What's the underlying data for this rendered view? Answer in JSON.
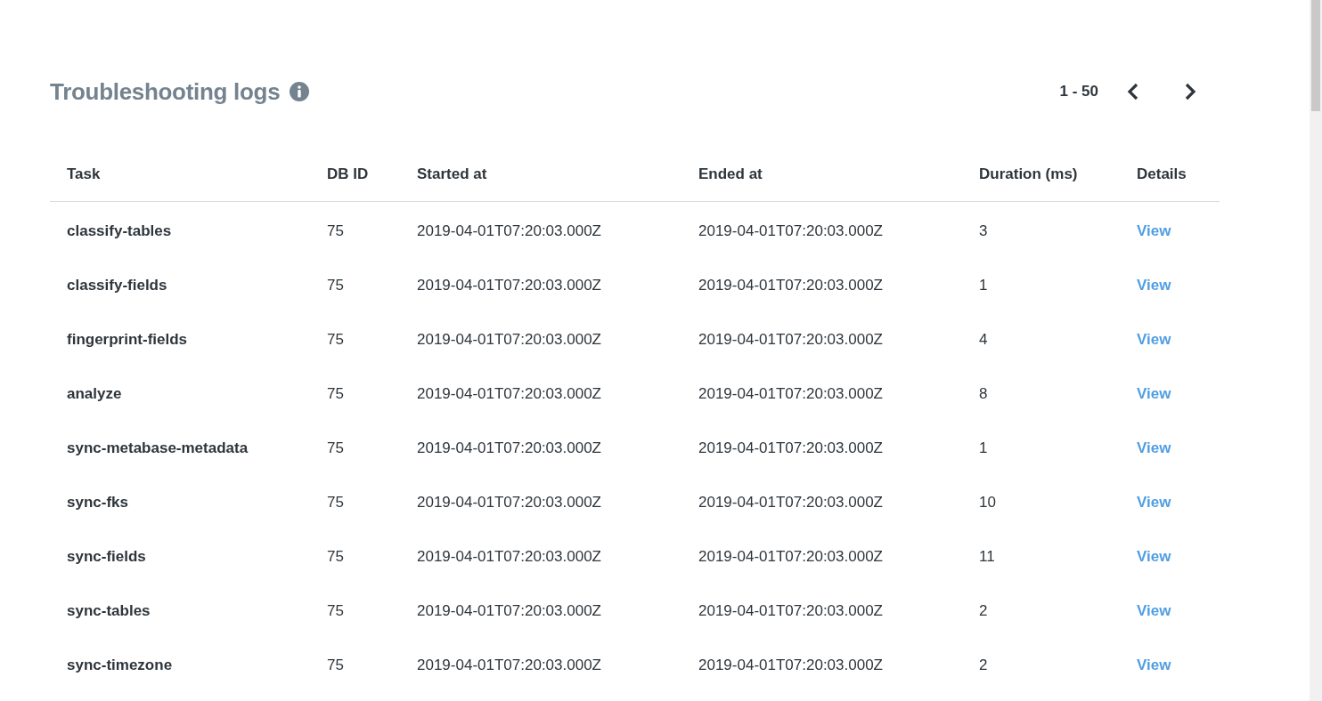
{
  "header": {
    "title": "Troubleshooting logs",
    "pagination": {
      "range": "1 - 50"
    }
  },
  "table": {
    "columns": [
      "Task",
      "DB ID",
      "Started at",
      "Ended at",
      "Duration (ms)",
      "Details"
    ],
    "rows": [
      {
        "task": "classify-tables",
        "db_id": "75",
        "started_at": "2019-04-01T07:20:03.000Z",
        "ended_at": "2019-04-01T07:20:03.000Z",
        "duration": "3",
        "details": "View"
      },
      {
        "task": "classify-fields",
        "db_id": "75",
        "started_at": "2019-04-01T07:20:03.000Z",
        "ended_at": "2019-04-01T07:20:03.000Z",
        "duration": "1",
        "details": "View"
      },
      {
        "task": "fingerprint-fields",
        "db_id": "75",
        "started_at": "2019-04-01T07:20:03.000Z",
        "ended_at": "2019-04-01T07:20:03.000Z",
        "duration": "4",
        "details": "View"
      },
      {
        "task": "analyze",
        "db_id": "75",
        "started_at": "2019-04-01T07:20:03.000Z",
        "ended_at": "2019-04-01T07:20:03.000Z",
        "duration": "8",
        "details": "View"
      },
      {
        "task": "sync-metabase-metadata",
        "db_id": "75",
        "started_at": "2019-04-01T07:20:03.000Z",
        "ended_at": "2019-04-01T07:20:03.000Z",
        "duration": "1",
        "details": "View"
      },
      {
        "task": "sync-fks",
        "db_id": "75",
        "started_at": "2019-04-01T07:20:03.000Z",
        "ended_at": "2019-04-01T07:20:03.000Z",
        "duration": "10",
        "details": "View"
      },
      {
        "task": "sync-fields",
        "db_id": "75",
        "started_at": "2019-04-01T07:20:03.000Z",
        "ended_at": "2019-04-01T07:20:03.000Z",
        "duration": "11",
        "details": "View"
      },
      {
        "task": "sync-tables",
        "db_id": "75",
        "started_at": "2019-04-01T07:20:03.000Z",
        "ended_at": "2019-04-01T07:20:03.000Z",
        "duration": "2",
        "details": "View"
      },
      {
        "task": "sync-timezone",
        "db_id": "75",
        "started_at": "2019-04-01T07:20:03.000Z",
        "ended_at": "2019-04-01T07:20:03.000Z",
        "duration": "2",
        "details": "View"
      }
    ]
  }
}
